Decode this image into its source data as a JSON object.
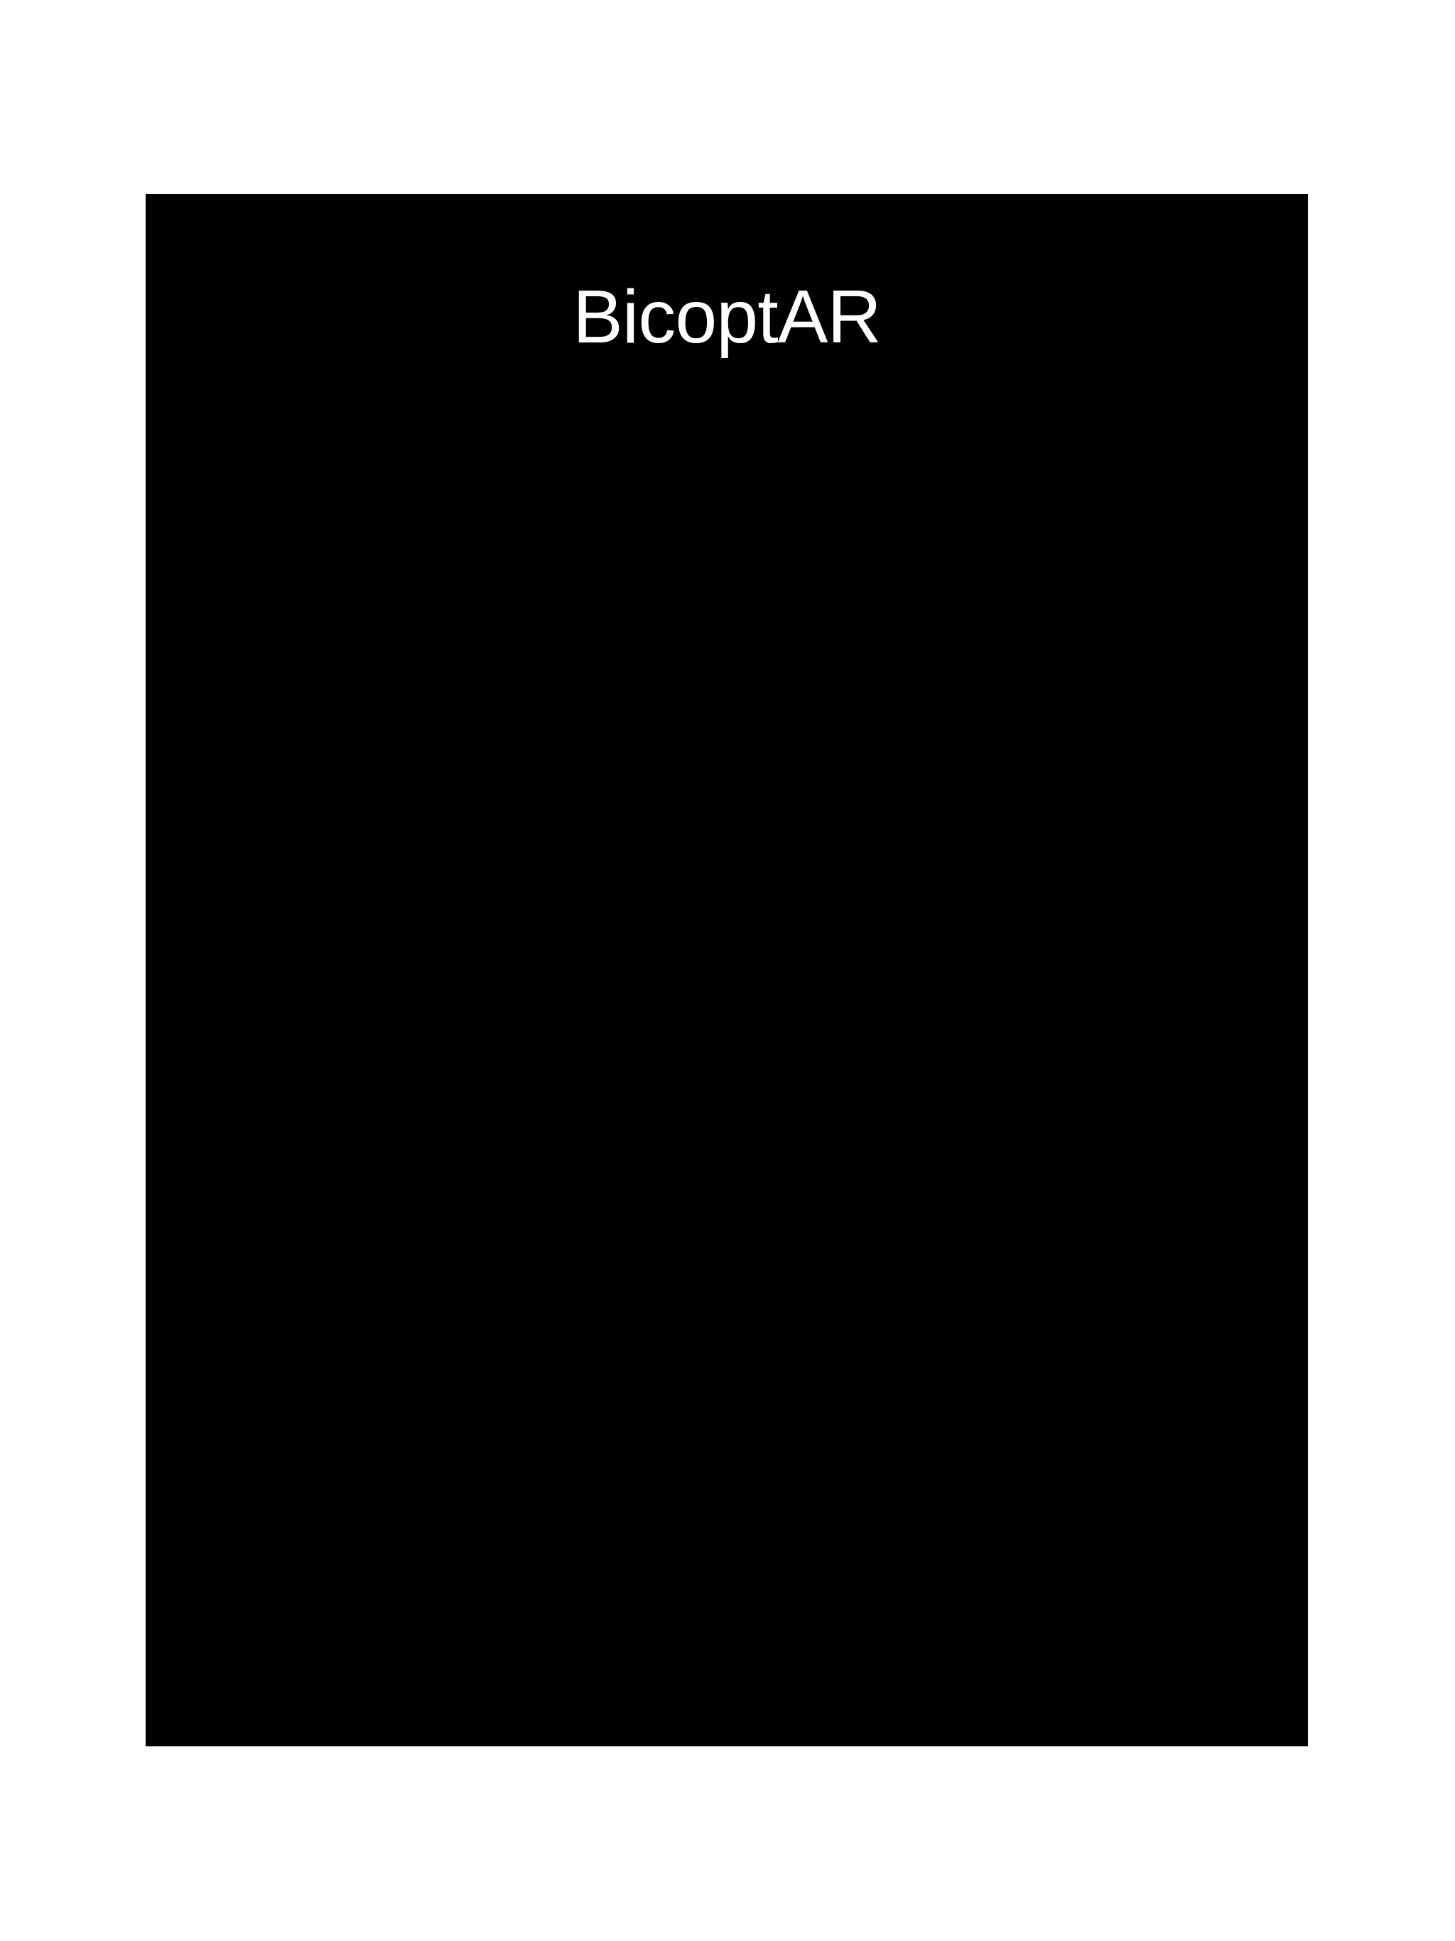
{
  "app": {
    "title": "BicoptAR"
  },
  "colors": {
    "page_background": "#ffffff",
    "screen_background": "#000000",
    "title_text": "#ffffff"
  }
}
